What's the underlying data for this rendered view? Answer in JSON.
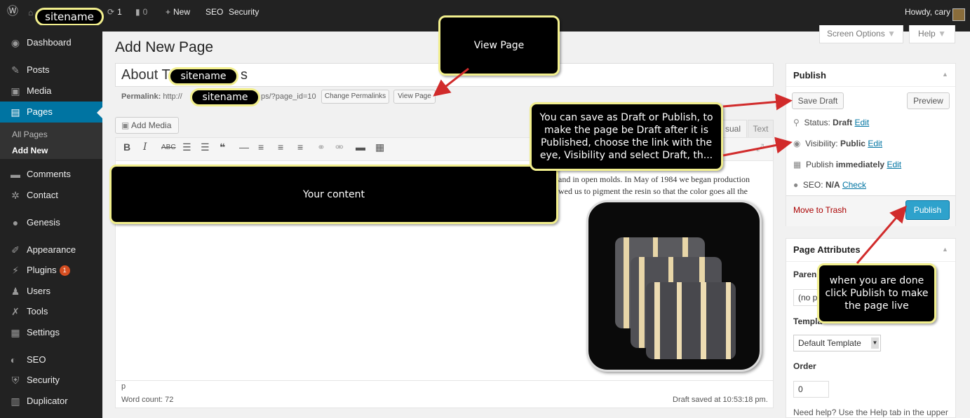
{
  "adminbar": {
    "sitename": "sitename",
    "updates_count": "1",
    "comments_count": "0",
    "new_label": "New",
    "seo_label": "SEO",
    "security_label": "Security",
    "howdy": "Howdy, cary"
  },
  "sidebar": {
    "items": [
      {
        "label": "Dashboard"
      },
      {
        "label": "Posts"
      },
      {
        "label": "Media"
      },
      {
        "label": "Pages"
      },
      {
        "label": "Comments"
      },
      {
        "label": "Contact"
      },
      {
        "label": "Genesis"
      },
      {
        "label": "Appearance"
      },
      {
        "label": "Plugins",
        "badge": "1"
      },
      {
        "label": "Users"
      },
      {
        "label": "Tools"
      },
      {
        "label": "Settings"
      },
      {
        "label": "SEO"
      },
      {
        "label": "Security"
      },
      {
        "label": "Duplicator"
      }
    ],
    "submenu": {
      "all_pages": "All Pages",
      "add_new": "Add New"
    }
  },
  "header": {
    "page_title": "Add New Page",
    "screen_options": "Screen Options",
    "help": "Help"
  },
  "editor": {
    "title_prefix": "About T",
    "title_suffix": "s",
    "permalink_label": "Permalink:",
    "permalink_start": "http://",
    "permalink_end": "ps/?page_id=10",
    "change_permalinks": "Change Permalinks",
    "view_page": "View Page",
    "add_media": "Add Media",
    "tab_visual": "sual",
    "tab_text": "Text",
    "content_line1": "hand in open molds. In May of 1984 we began production",
    "content_line2": "owed us to pigment the resin so that the color goes all the",
    "path": "p",
    "word_count": "Word count: 72",
    "draft_saved": "Draft saved at 10:53:18 pm."
  },
  "publish_box": {
    "title": "Publish",
    "save_draft": "Save Draft",
    "preview": "Preview",
    "status_label": "Status:",
    "status_value": "Draft",
    "visibility_label": "Visibility:",
    "visibility_value": "Public",
    "publish_label": "Publish",
    "publish_value": "immediately",
    "seo_label": "SEO:",
    "seo_value": "N/A",
    "seo_link": "Check",
    "edit": "Edit",
    "move_to_trash": "Move to Trash",
    "publish_button": "Publish"
  },
  "page_attributes": {
    "title": "Page Attributes",
    "parent_label": "Paren",
    "parent_value": "(no p",
    "template_label": "Templa",
    "template_value": "Default Template",
    "order_label": "Order",
    "order_value": "0",
    "help_text": "Need help? Use the Help tab in the upper"
  },
  "callouts": {
    "view_page": "View Page",
    "your_content": "Your content",
    "save_publish": "You can save as Draft or Publish, to make the page be Draft after it is Published, choose the link with the eye, Visibility and select Draft, th...",
    "publish_done": "when you  are done click Publish to make the page live",
    "sitename": "sitename"
  },
  "colors": {
    "accent": "#0074a2",
    "adminbar": "#222222",
    "callout_border": "#f2ef8d",
    "arrow": "#d12b2b",
    "trash": "#a00000"
  }
}
